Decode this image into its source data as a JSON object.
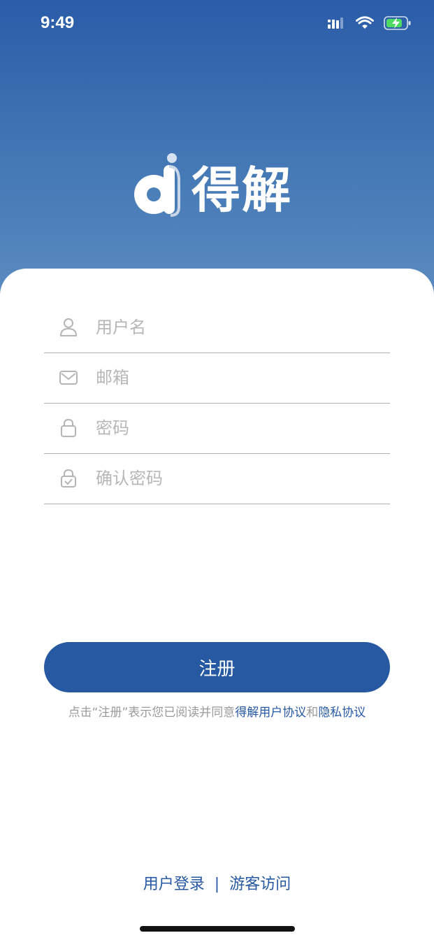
{
  "status_bar": {
    "time": "9:49",
    "icons": [
      "cellular-signal-icon",
      "wifi-icon",
      "battery-charging-icon"
    ]
  },
  "brand": {
    "logo_icon": "d-logo-icon",
    "name": "得解"
  },
  "form": {
    "fields": [
      {
        "name": "username",
        "icon": "user-icon",
        "placeholder": "用户名",
        "value": ""
      },
      {
        "name": "email",
        "icon": "mail-icon",
        "placeholder": "邮箱",
        "value": ""
      },
      {
        "name": "password",
        "icon": "lock-icon",
        "placeholder": "密码",
        "value": ""
      },
      {
        "name": "confirm-password",
        "icon": "lock-check-icon",
        "placeholder": "确认密码",
        "value": ""
      }
    ],
    "register_label": "注册"
  },
  "agreement": {
    "prefix": "点击“注册”表示您已阅读并同意",
    "user_agreement": "得解用户协议",
    "and": "和",
    "privacy_policy": "隐私协议"
  },
  "footer": {
    "login_label": "用户登录",
    "separator": "|",
    "guest_label": "游客访问"
  },
  "colors": {
    "primary": "#2759a3",
    "hero_top": "#2a5ca8",
    "hero_bottom": "#5b8cc0",
    "placeholder": "#b7b7b7",
    "divider": "#b0b0b0"
  }
}
